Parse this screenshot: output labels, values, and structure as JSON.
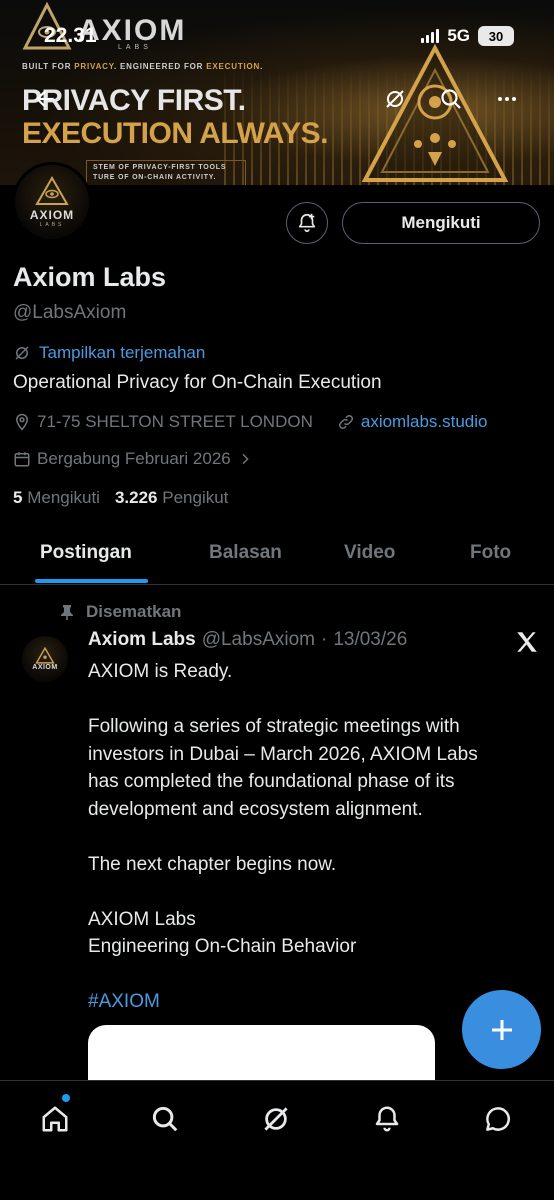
{
  "status_bar": {
    "time": "22.31",
    "network": "5G",
    "battery": "30"
  },
  "banner": {
    "logo_text": "AXIOM",
    "logo_sub": "LABS",
    "tagline_prefix": "BUILT FOR ",
    "tagline_privacy": "PRIVACY",
    "tagline_mid": ". ENGINEERED FOR ",
    "tagline_execution": "EXECUTION",
    "tagline_end": ".",
    "headline_1": "PRIVACY FIRST.",
    "headline_2": "EXECUTION ALWAYS.",
    "desc_line_1": "STEM OF PRIVACY-FIRST TOOLS",
    "desc_line_2": "TURE OF ON-CHAIN ACTIVITY."
  },
  "profile": {
    "avatar_text": "AXIOM",
    "avatar_sub": "LABS",
    "follow_button": "Mengikuti",
    "display_name": "Axiom Labs",
    "handle": "@LabsAxiom",
    "translate_label": "Tampilkan terjemahan",
    "bio": "Operational Privacy for On-Chain Execution",
    "location": "71-75 SHELTON STREET LONDON",
    "website": "axiomlabs.studio",
    "joined": "Bergabung Februari 2026",
    "following_count": "5",
    "following_label": "Mengikuti",
    "followers_count": "3.226",
    "followers_label": "Pengikut"
  },
  "tabs": [
    {
      "label": "Postingan",
      "active": true
    },
    {
      "label": "Balasan",
      "active": false
    },
    {
      "label": "Video",
      "active": false
    },
    {
      "label": "Foto",
      "active": false
    }
  ],
  "post": {
    "pinned_label": "Disematkan",
    "author": "Axiom Labs",
    "handle": "@LabsAxiom",
    "separator": "·",
    "date": "13/03/26",
    "avatar_text": "AXIOM",
    "lines": {
      "l1": "AXIOM is Ready.",
      "l2": "Following a series of strategic meetings with",
      "l3": "investors in Dubai – March 2026, AXIOM Labs",
      "l4": "has completed the foundational phase of its",
      "l5": "development and ecosystem alignment.",
      "l6": "The next chapter begins now.",
      "l7": "AXIOM Labs",
      "l8": "Engineering On-Chain Behavior",
      "hashtag": "#AXIOM"
    }
  },
  "icons": {
    "back": "arrow-left-icon",
    "grok": "grok-icon",
    "search": "search-icon",
    "more": "more-icon",
    "notify": "notification-add-icon",
    "x": "x-logo-icon",
    "fab": "plus-icon",
    "nav": [
      "home-icon",
      "search-icon",
      "grok-icon",
      "bell-icon",
      "messages-icon"
    ]
  },
  "colors": {
    "accent": "#1d9bf0",
    "link": "#4a9be0",
    "gold": "#d4a24a",
    "fab": "#3a8ee0"
  }
}
